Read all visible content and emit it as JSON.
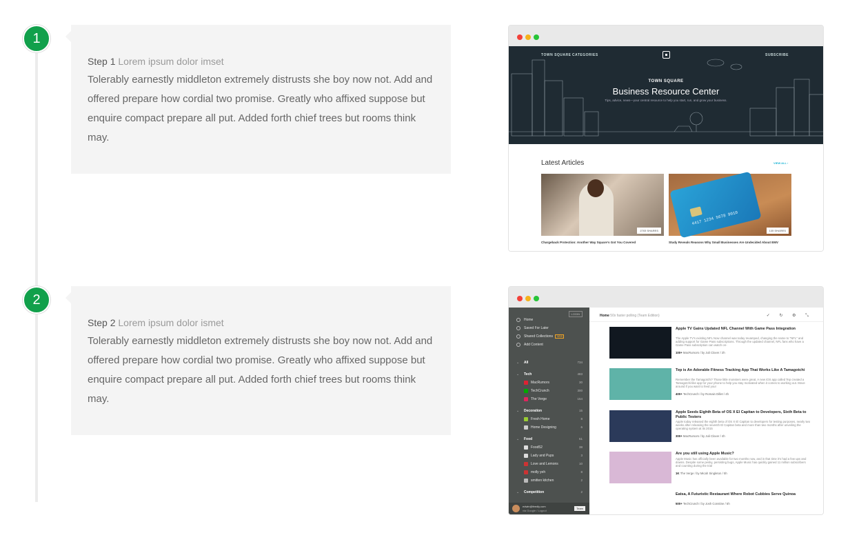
{
  "steps": [
    {
      "num": "1",
      "title": "Step 1",
      "title_light": "Lorem ipsum dolor imset",
      "text": "Tolerably earnestly middleton extremely distrusts she boy now not. Add and offered prepare how cordial two promise. Greatly who affixed suppose but enquire compact prepare all put. Added forth chief trees but rooms think may."
    },
    {
      "num": "2",
      "title": "Step 2",
      "title_light": "Lorem ipsum dolor ismet",
      "text": "Tolerably earnestly middleton extremely distrusts she boy now not. Add and offered prepare how cordial two promise. Greatly who affixed suppose but enquire compact prepare all put. Added forth chief trees but rooms think may."
    }
  ],
  "shot1": {
    "nav_left_1": "TOWN SQUARE",
    "nav_left_2": "CATEGORIES",
    "nav_right": "SUBSCRIBE",
    "kicker": "TOWN SQUARE",
    "title": "Business Resource Center",
    "subtitle": "Tips, advice, news—your central resource to help you start, run, and grow your business.",
    "section": "Latest Articles",
    "view_all": "VIEW ALL ›",
    "articles": [
      {
        "shares": "2765 SHARES",
        "caption": "Chargeback Protection: Another Way Square's Got You Covered"
      },
      {
        "shares": "135 SHARES",
        "caption": "Study Reveals Reasons Why Small Businesses Are Undecided About EMV"
      }
    ],
    "card_text": "4417 1234 5678 9010"
  },
  "shot2": {
    "login": "LOGIN",
    "nav": [
      {
        "label": "Home"
      },
      {
        "label": "Saved For Later"
      },
      {
        "label": "Shared Collections",
        "badge": "NEW"
      },
      {
        "label": "Add Content"
      }
    ],
    "feeds": [
      {
        "label": "All",
        "count": "734",
        "section": true
      },
      {
        "label": "Tech",
        "count": "483",
        "section": true
      },
      {
        "label": "MacRumors",
        "count": "30",
        "color": "#d23"
      },
      {
        "label": "TechCrunch",
        "count": "300",
        "color": "#0a0"
      },
      {
        "label": "The Verge",
        "count": "154",
        "color": "#e0245e"
      },
      {
        "label": "Decoration",
        "count": "15",
        "section": true
      },
      {
        "label": "Fresh Home",
        "count": "8",
        "color": "#9c3"
      },
      {
        "label": "Home Designing",
        "count": "6",
        "color": "#ccc"
      },
      {
        "label": "Food",
        "count": "61",
        "section": true
      },
      {
        "label": "Food52",
        "count": "38",
        "color": "#ddd"
      },
      {
        "label": "Lady and Pups",
        "count": "3",
        "color": "#ddd"
      },
      {
        "label": "Love and Lemons",
        "count": "10",
        "color": "#c33"
      },
      {
        "label": "molly yeh",
        "count": "8",
        "color": "#c33"
      },
      {
        "label": "smitten kitchen",
        "count": "2",
        "color": "#bbb"
      },
      {
        "label": "Competition",
        "count": "2",
        "section": true
      }
    ],
    "user_email": "edwin@feedly.com",
    "user_sub": "via Google / Logout",
    "team": "Team",
    "header_title": "Home",
    "header_sub": "50x faster polling (Team Edition)",
    "tools": "✓ ↻ ⚙ ⤡",
    "entries": [
      {
        "title": "Apple TV Gains Updated NFL Channel With Game Pass Integration",
        "desc": "The Apple TV's existing NFL Now channel was today revamped, changing the name to \"NFL\" and adding support for Game Pass subscriptions. Through the updated channel, NFL fans who have a Game Pass subscription can watch on-",
        "count": "100+",
        "meta": "MacRumors / by Juli Clover / 2h",
        "thumb": "#111820"
      },
      {
        "title": "Tep is An Adorable Fitness Tracking App That Works Like A Tamagotchi",
        "desc": "Remember the Tamagotchi? Those little monsters were great. A new iOS app called Tep created a Tamagotchi-like app for your phone to help you stay motivated when it comes to working out. Move around if you want to feed your",
        "count": "400+",
        "meta": "TechCrunch / by Romain Dillet / 4h",
        "thumb": "#5fb3a8"
      },
      {
        "title": "Apple Seeds Eighth Beta of OS X El Capitan to Developers, Sixth Beta to Public Testers",
        "desc": "Apple today released the eighth beta of OS X El Capitan to developers for testing purposes, nearly two weeks after releasing the seventh El Capitan beta and more than two months after unveiling the operating system at its 2015",
        "count": "300+",
        "meta": "MacRumors / by Juli Clover / 4h",
        "thumb": "#2b3a5a"
      },
      {
        "title": "Are you still using Apple Music?",
        "desc": "Apple Music has officially been available for two months now, and in that time it's had a few ups and downs. Despite some pesky, persisting bugs, Apple Music has quickly gained 11 million subscribers and counting during the trial",
        "count": "1K",
        "meta": "The Verge / by Micah Singleton / 5h",
        "thumb": "#d9b8d6"
      },
      {
        "title": "Eatsa, A Futuristic Restaurant Where Robot Cubbies Serve Quinoa",
        "desc": "",
        "count": "500+",
        "meta": "TechCrunch / by Josh Constine / 5h",
        "thumb": ""
      }
    ]
  }
}
